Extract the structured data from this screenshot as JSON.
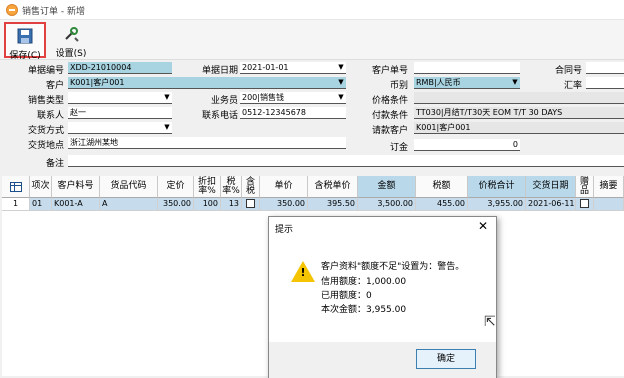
{
  "window": {
    "title": "销售订单 - 新增"
  },
  "toolbar": {
    "save_label": "保存(C)",
    "setup_label": "设置(S)"
  },
  "form": {
    "doc_no_label": "单据编号",
    "doc_no": "XDD-21010004",
    "doc_date_label": "单据日期",
    "doc_date": "2021-01-01",
    "cust_doc_label": "客户单号",
    "cust_doc": "",
    "contract_label": "合同号",
    "contract": "",
    "customer_label": "客户",
    "customer": "K001|客户001",
    "currency_label": "币别",
    "currency": "RMB|人民币",
    "rate_label": "汇率",
    "rate": "",
    "sales_type_label": "销售类型",
    "sales_type": "",
    "salesman_label": "业务员",
    "salesman": "200|销售钱",
    "price_cond_label": "价格条件",
    "price_cond": "",
    "contact_label": "联系人",
    "contact": "赵一",
    "phone_label": "联系电话",
    "phone": "0512-12345678",
    "pay_cond_label": "付款条件",
    "pay_cond": "TT030|月结T/T30天 EOM T/T 30 DAYS",
    "trade_label": "交货方式",
    "trade": "",
    "pay_cust_label": "请款客户",
    "pay_cust": "K001|客户001",
    "place_label": "交货地点",
    "place": "浙江湖州某地",
    "deposit_label": "订金",
    "deposit": "0",
    "remark_label": "备注",
    "remark": ""
  },
  "grid": {
    "headers": [
      "项次",
      "客户料号",
      "货品代码",
      "定价",
      "折扣率%",
      "税率%",
      "含税",
      "单价",
      "含税单价",
      "金额",
      "税额",
      "价税合计",
      "交货日期",
      "赠品",
      "摘要"
    ],
    "row": {
      "no": "1",
      "item": "01",
      "cust_part": "K001-A",
      "code": "A",
      "list_price": "350.00",
      "discount": "100",
      "tax_rate": "13",
      "price": "350.00",
      "tax_price": "395.50",
      "amount": "3,500.00",
      "tax": "455.00",
      "total": "3,955.00",
      "date": "2021-06-11"
    }
  },
  "dialog": {
    "title": "提示",
    "line1": "客户资料\"额度不足\"设置为：警告。",
    "line2": "信用额度：1,000.00",
    "line3": "已用额度：0",
    "line4": "本次金额：3,955.00",
    "ok_label": "确定"
  }
}
